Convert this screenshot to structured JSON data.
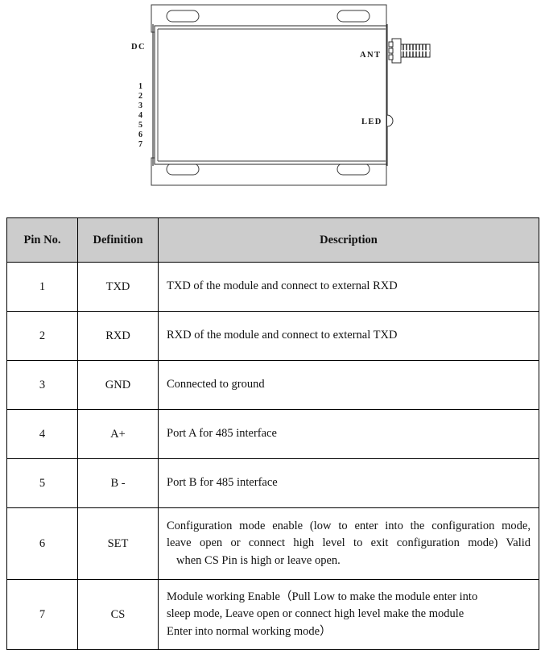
{
  "diagram": {
    "name": "wireless-module-mechanical-drawing",
    "labels": {
      "dc": "DC",
      "ant": "ANT",
      "led": "LED"
    },
    "pin_numbers": [
      "1",
      "2",
      "3",
      "4",
      "5",
      "6",
      "7"
    ],
    "stroke_color": "#333333",
    "background": "#ffffff"
  },
  "pin_table": {
    "header": {
      "pin_no": "Pin No.",
      "definition": "Definition",
      "description": "Description"
    },
    "header_bg": "#cccccc",
    "rows": [
      {
        "pin": "1",
        "definition": "TXD",
        "description": "TXD of the module and connect to external RXD",
        "lines": [
          "TXD of the module and connect to external RXD"
        ]
      },
      {
        "pin": "2",
        "definition": "RXD",
        "description": "RXD of the module and connect to external TXD",
        "lines": [
          "RXD of the module and connect to external TXD"
        ]
      },
      {
        "pin": "3",
        "definition": "GND",
        "description": "Connected to ground",
        "lines": [
          "Connected to ground"
        ]
      },
      {
        "pin": "4",
        "definition": "A+",
        "description": "Port A for 485 interface",
        "lines": [
          "Port A for 485 interface"
        ]
      },
      {
        "pin": "5",
        "definition": "B -",
        "description": "Port B for 485 interface",
        "lines": [
          "Port B for 485 interface"
        ]
      },
      {
        "pin": "6",
        "definition": "SET",
        "description": "Configuration mode enable (low to enter into the configuration mode, leave open or connect high level to exit configuration mode) Valid when CS Pin is high or leave open.",
        "lines": [
          "Configuration mode enable (low to enter into the configuration mode,",
          "leave open or connect high level to exit configuration mode) Valid",
          "when CS Pin is high or leave open."
        ]
      },
      {
        "pin": "7",
        "definition": "CS",
        "description": "Module working Enable（Pull Low to make the module enter into sleep mode, Leave open or connect high level make the module Enter into normal working mode）",
        "lines": [
          "Module working Enable（Pull Low to make the module enter into",
          "sleep mode, Leave open or connect high level make the module",
          "Enter into normal working mode）"
        ]
      }
    ]
  }
}
